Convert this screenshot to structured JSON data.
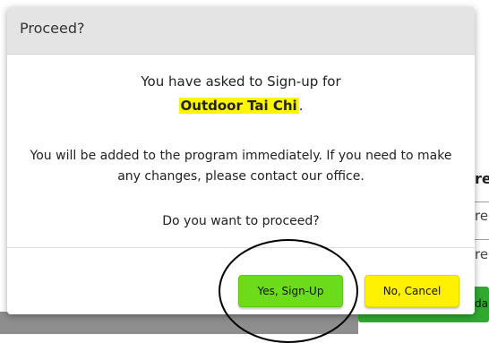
{
  "background": {
    "fragment_1": "re",
    "fragment_2": "re",
    "fragment_3": "re",
    "button_fragment": "da"
  },
  "dialog": {
    "title": "Proceed?",
    "message_line1": "You have asked to Sign-up for",
    "program_name": "Outdoor Tai Chi",
    "program_suffix": ".",
    "message_line2": "You will be added to the program immediately. If you need to make any changes, please contact our office.",
    "question": "Do you want to proceed?",
    "confirm_label": "Yes, Sign-Up",
    "cancel_label": "No, Cancel"
  },
  "colors": {
    "confirm_button": "#6cdc1a",
    "cancel_button": "#fff100",
    "highlight": "#fff600",
    "header_bg": "#e4e4e4"
  }
}
